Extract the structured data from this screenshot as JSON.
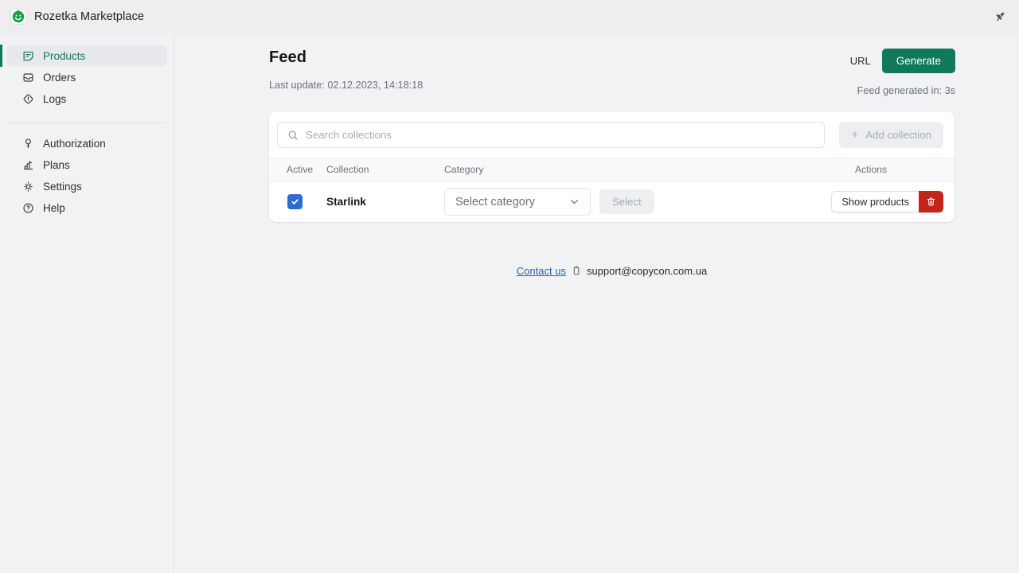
{
  "topbar": {
    "app_title": "Rozetka Marketplace",
    "logo_icon": "rozetka-logo-icon",
    "pin_icon": "pushpin-icon"
  },
  "sidebar": {
    "groups": [
      {
        "items": [
          {
            "label": "Products",
            "icon": "note-icon",
            "active": true
          },
          {
            "label": "Orders",
            "icon": "inbox-icon",
            "active": false
          },
          {
            "label": "Logs",
            "icon": "diamond-alert-icon",
            "active": false
          }
        ]
      },
      {
        "items": [
          {
            "label": "Authorization",
            "icon": "key-icon",
            "active": false
          },
          {
            "label": "Plans",
            "icon": "chart-steps-icon",
            "active": false
          },
          {
            "label": "Settings",
            "icon": "gear-icon",
            "active": false
          },
          {
            "label": "Help",
            "icon": "question-circle-icon",
            "active": false
          }
        ]
      }
    ]
  },
  "page": {
    "title": "Feed",
    "last_update": "Last update: 02.12.2023, 14:18:18",
    "url_label": "URL",
    "generate_label": "Generate",
    "generated_note": "Feed generated in: 3s",
    "accent_green": "#10795a"
  },
  "card": {
    "search_placeholder": "Search collections",
    "search_value": "",
    "search_icon": "search-icon",
    "add_collection_label": "Add collection",
    "add_collection_plus": "+",
    "table": {
      "headers": [
        "Active",
        "Collection",
        "Category",
        "Actions"
      ],
      "rows": [
        {
          "active": true,
          "collection": "Starlink",
          "category_placeholder": "Select category",
          "select_button_label": "Select",
          "show_products_label": "Show products",
          "delete_icon": "trash-icon",
          "delete_color": "#c4241a"
        }
      ]
    }
  },
  "footer": {
    "contact_link": "Contact us",
    "copy_icon": "copy-icon",
    "email": "support@copycon.com.ua"
  }
}
